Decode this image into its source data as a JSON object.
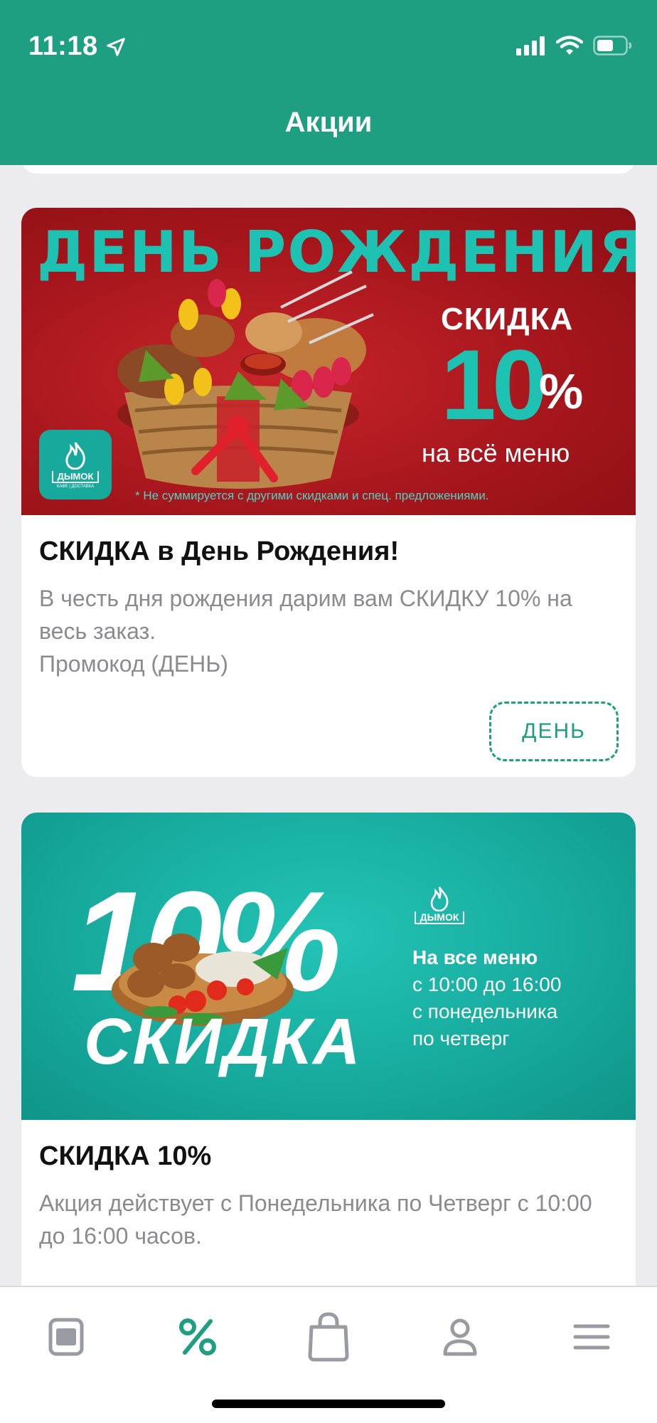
{
  "status_bar": {
    "time": "11:18"
  },
  "header": {
    "title": "Акции"
  },
  "promotions": [
    {
      "banner": {
        "headline": "ДЕНЬ РОЖДЕНИЯ?",
        "discount_label": "СКИДКА",
        "discount_value": "10",
        "discount_percent": "%",
        "scope": "на всё меню",
        "footnote": "* Не суммируется с другими скидками и спец. предложениями.",
        "logo_text": "ДЫМОК",
        "logo_subtext": "КАФЕ | ДОСТАВКА"
      },
      "title": "СКИДКА в День Рождения!",
      "description": "В честь дня рождения дарим вам СКИДКУ 10% на весь заказ.",
      "promo_line": "Промокод (ДЕНЬ)",
      "promo_code": "ДЕНЬ"
    },
    {
      "banner": {
        "big_percent": "10%",
        "big_word": "СКИДКА",
        "logo_text": "ДЫМОК",
        "line1": "На все меню",
        "line2": "с 10:00 до 16:00",
        "line3": "с понедельника",
        "line4": "по четверг"
      },
      "title": "СКИДКА 10%",
      "description": "Акция действует с Понедельника по Четверг с 10:00 до 16:00 часов."
    }
  ],
  "tabbar": {
    "active_tab": "promotions",
    "tabs": [
      "menu",
      "promotions",
      "cart",
      "profile",
      "more"
    ]
  },
  "colors": {
    "brand": "#1e9f82",
    "banner_red": "#a3151b",
    "banner_teal": "#16a99c",
    "inactive_icon": "#9a9aa3"
  }
}
